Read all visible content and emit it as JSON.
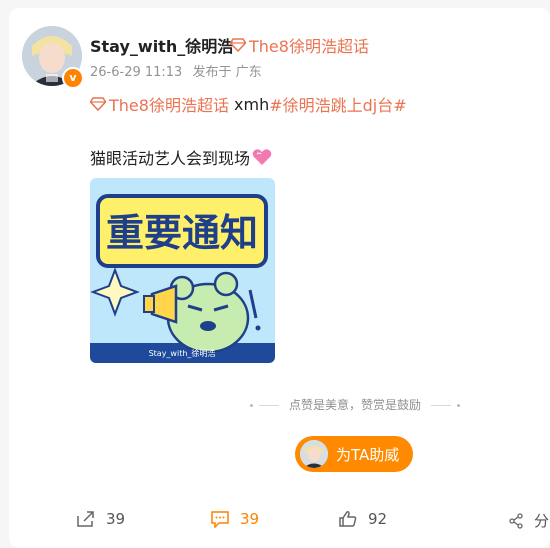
{
  "post": {
    "username": "Stay_with_徐明浩",
    "topic_tag": "The8徐明浩超话",
    "timestamp": "26-6-29 11:13",
    "location": "发布于 广东",
    "line2_tag": "The8徐明浩超话",
    "line2_mid": " xmh",
    "line2_hashtag": "#徐明浩跳上dj台#",
    "body": "猫眼活动艺人会到现场",
    "image_title": "重要通知",
    "image_watermark": "Stay_with_徐明浩"
  },
  "reward": {
    "text": "点赞是美意，赞赏是鼓励",
    "button_label": "为TA助威"
  },
  "actions": {
    "share_count": "39",
    "comment_count": "39",
    "like_count": "92",
    "more_label": "分"
  },
  "colors": {
    "accent": "#ff8200",
    "tag": "#eb7350"
  }
}
